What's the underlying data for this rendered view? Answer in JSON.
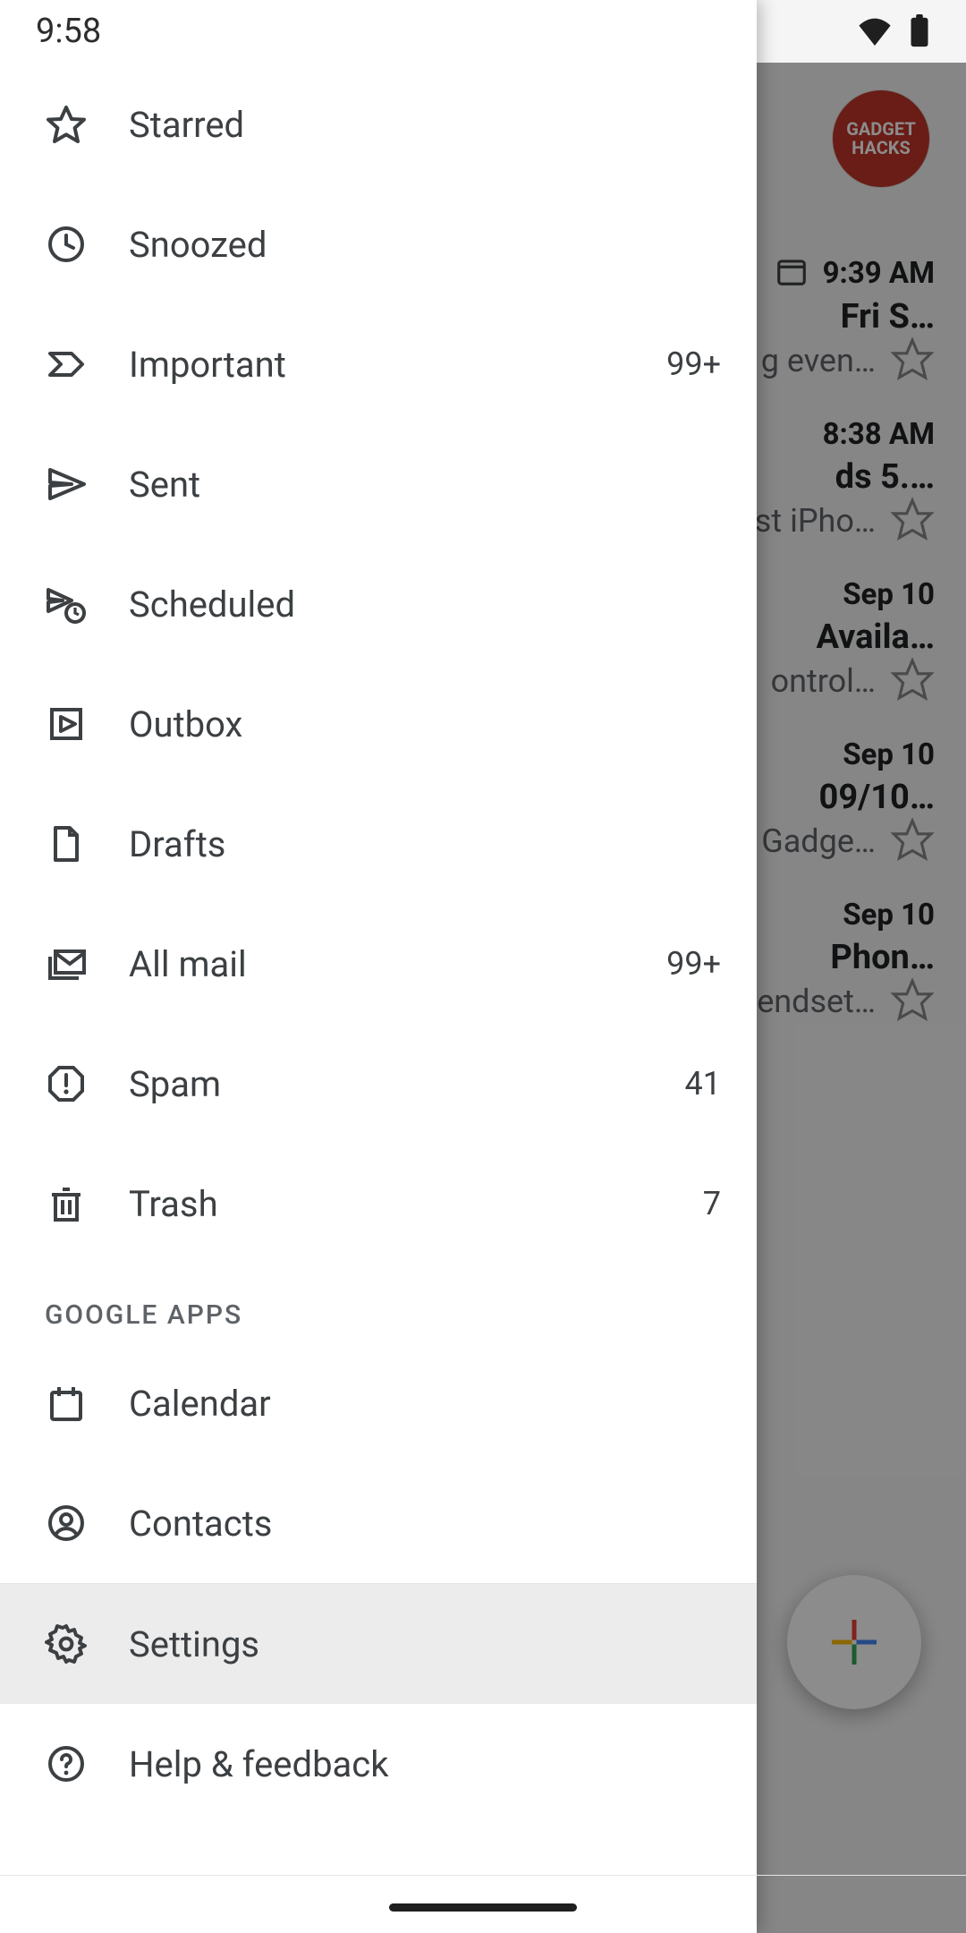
{
  "status": {
    "time": "9:58"
  },
  "drawer": {
    "items": [
      {
        "label": "Starred",
        "count": ""
      },
      {
        "label": "Snoozed",
        "count": ""
      },
      {
        "label": "Important",
        "count": "99+"
      },
      {
        "label": "Sent",
        "count": ""
      },
      {
        "label": "Scheduled",
        "count": ""
      },
      {
        "label": "Outbox",
        "count": ""
      },
      {
        "label": "Drafts",
        "count": ""
      },
      {
        "label": "All mail",
        "count": "99+"
      },
      {
        "label": "Spam",
        "count": "41"
      },
      {
        "label": "Trash",
        "count": "7"
      }
    ],
    "section_header": "GOOGLE APPS",
    "apps": [
      {
        "label": "Calendar"
      },
      {
        "label": "Contacts"
      }
    ],
    "footer": [
      {
        "label": "Settings"
      },
      {
        "label": "Help & feedback"
      }
    ]
  },
  "inbox": {
    "avatar_text": "GADGET HACKS",
    "emails": [
      {
        "time": "9:39 AM",
        "subject": "Fri S…",
        "preview": "g even…"
      },
      {
        "time": "8:38 AM",
        "subject": "ds 5.…",
        "preview": "st iPho…"
      },
      {
        "time": "Sep 10",
        "subject": "Availa…",
        "preview": "ontrol…"
      },
      {
        "time": "Sep 10",
        "subject": "09/10…",
        "preview": "Gadge…"
      },
      {
        "time": "Sep 10",
        "subject": "Phon…",
        "preview": "endset…"
      }
    ]
  }
}
